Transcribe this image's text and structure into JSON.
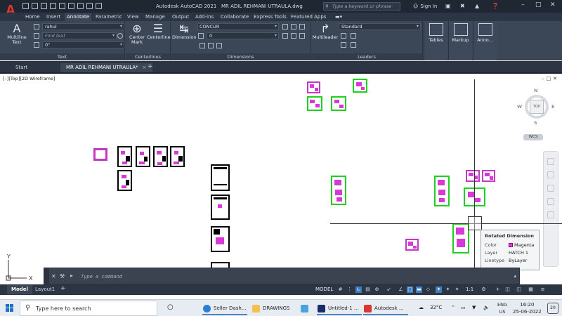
{
  "titlebar": {
    "app_title": "Autodesk AutoCAD 2021",
    "file_name": "MR ADIL REHMANI UTRAULA.dwg",
    "search_placeholder": "Type a keyword or phrase",
    "signin": "Sign In"
  },
  "ribbon_tabs": [
    "Home",
    "Insert",
    "Annotate",
    "Parametric",
    "View",
    "Manage",
    "Output",
    "Add-ins",
    "Collaborate",
    "Express Tools",
    "Featured Apps"
  ],
  "active_ribbon_tab": "Annotate",
  "ribbon": {
    "multiline_text": "Multiline\nText",
    "text_style": "rahul",
    "find_text_placeholder": "Find text",
    "text_height": "0\"",
    "text_panel": "Text",
    "center_mark": "Center\nMark",
    "centerline": "Centerline",
    "centerlines_panel": "Centerlines",
    "dimension": "Dimension",
    "dim_style": "CONCUR",
    "dim_layer": "0",
    "dimensions_panel": "Dimensions",
    "multileader": "Multileader",
    "leader_style": "Standard",
    "leaders_panel": "Leaders",
    "tables": "Tables",
    "markup": "Markup",
    "annotation": "Anno..."
  },
  "doc_tabs": {
    "start": "Start",
    "active_doc": "MR ADIL REHMANI UTRAULA*"
  },
  "viewport": {
    "label": "[–][Top][2D Wireframe]",
    "viewcube_top": "TOP",
    "compass_n": "N",
    "compass_s": "S",
    "compass_e": "E",
    "compass_w": "W",
    "wcs": "WCS"
  },
  "tooltip": {
    "title": "Rotated Dimension",
    "rows": [
      {
        "key": "Color",
        "value": "Magenta"
      },
      {
        "key": "Layer",
        "value": "HATCH 1"
      },
      {
        "key": "Linetype",
        "value": "ByLayer"
      }
    ]
  },
  "ucs": {
    "x": "X",
    "y": "Y"
  },
  "command_line": {
    "placeholder": "Type a command"
  },
  "layout_tabs": [
    "Model",
    "Layout1"
  ],
  "status": {
    "model": "MODEL",
    "scale": "1:1"
  },
  "taskbar": {
    "search_placeholder": "Type here to search",
    "apps": [
      {
        "label": "Seller Dash...",
        "color": "#2a7fd4"
      },
      {
        "label": "DRAWINGS",
        "color": "#f2c14e"
      },
      {
        "label": "",
        "color": "#4aa3df"
      },
      {
        "label": "Untitled-1 ...",
        "color": "#1b2a6b"
      },
      {
        "label": "Autodesk ...",
        "color": "#d8362f"
      }
    ],
    "temperature": "32°C",
    "lang_top": "ENG",
    "lang_bottom": "US",
    "time": "16:20",
    "date": "25-06-2022",
    "notifications": "20"
  },
  "colors": {
    "magenta": "#d838d8",
    "green_highlight": "#20d020",
    "autocad_red": "#e3362f",
    "dark_ui": "#3b4656"
  }
}
